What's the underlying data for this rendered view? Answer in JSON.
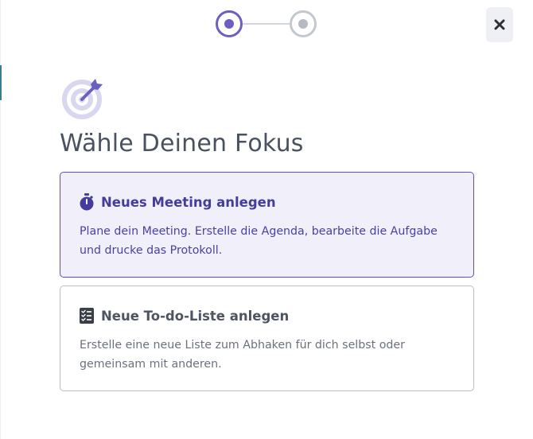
{
  "stepper": {
    "current_step": 1,
    "total_steps": 2
  },
  "close_button": {
    "symbol": "✕"
  },
  "title": "Wähle Deinen Fokus",
  "options": [
    {
      "icon": "stopwatch-icon",
      "title": "Neues Meeting anlegen",
      "description": "Plane dein Meeting. Erstelle die Agenda, bearbeite die Aufgabe und drucke das Protokoll.",
      "selected": true
    },
    {
      "icon": "checklist-icon",
      "title": "Neue To-do-Liste anlegen",
      "description": "Erstelle eine neue Liste zum Abhaken für dich selbst oder gemeinsam mit anderen.",
      "selected": false
    }
  ],
  "colors": {
    "accent": "#5c51b8",
    "accent_light": "#f1f0fa",
    "title_text": "#4a5260",
    "muted_text": "#6b717b",
    "border": "#b9bdc5"
  }
}
